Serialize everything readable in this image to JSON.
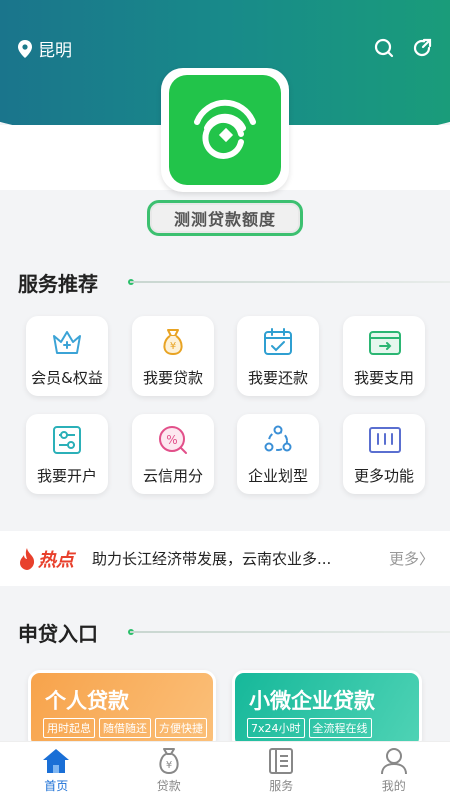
{
  "header": {
    "city": "昆明"
  },
  "quota_button": "测测贷款额度",
  "services": {
    "title": "服务推荐",
    "items": [
      {
        "label": "会员&权益",
        "icon": "crown-icon"
      },
      {
        "label": "我要贷款",
        "icon": "money-bag-icon"
      },
      {
        "label": "我要还款",
        "icon": "calendar-check-icon"
      },
      {
        "label": "我要支用",
        "icon": "card-transfer-icon"
      },
      {
        "label": "我要开户",
        "icon": "settings-sliders-icon"
      },
      {
        "label": "云信用分",
        "icon": "credit-score-icon"
      },
      {
        "label": "企业划型",
        "icon": "network-icon"
      },
      {
        "label": "更多功能",
        "icon": "more-grid-icon"
      }
    ]
  },
  "hot": {
    "label": "热点",
    "text": "助力长江经济带发展，云南农业多...",
    "more": "更多〉"
  },
  "loan_entry": {
    "title": "申贷入口",
    "cards": [
      {
        "title": "个人贷款",
        "tags": [
          "用时起息",
          "随借随还",
          "方便快捷"
        ]
      },
      {
        "title": "小微企业贷款",
        "tags": [
          "7x24小时",
          "全流程在线"
        ]
      }
    ]
  },
  "tabbar": [
    {
      "label": "首页",
      "active": true
    },
    {
      "label": "贷款",
      "active": false
    },
    {
      "label": "服务",
      "active": false
    },
    {
      "label": "我的",
      "active": false
    }
  ],
  "colors": {
    "brand_green": "#22c44a",
    "header_teal": "#188a8a",
    "hot_red": "#e8402c",
    "tab_active": "#1a6fd6"
  }
}
